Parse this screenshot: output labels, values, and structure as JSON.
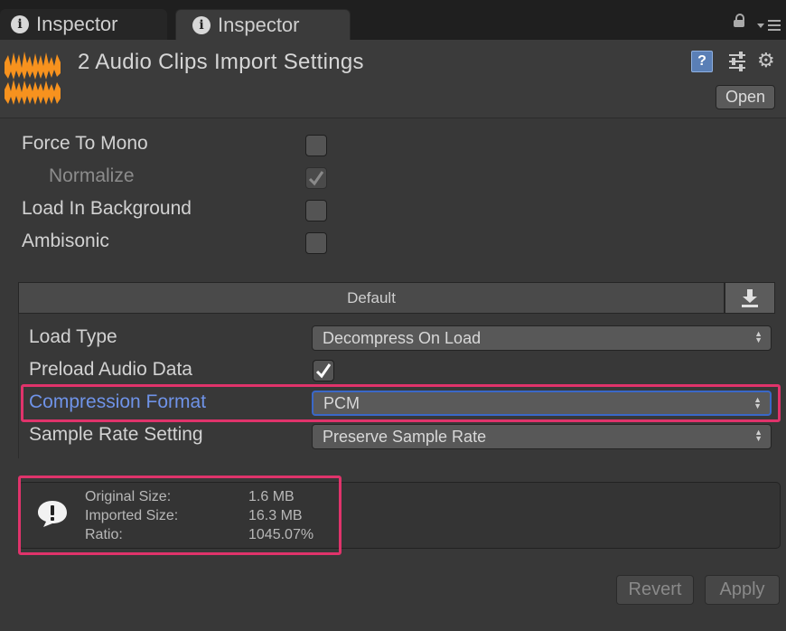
{
  "tabs": [
    {
      "label": "Inspector"
    },
    {
      "label": "Inspector"
    }
  ],
  "header": {
    "title": "2 Audio Clips Import Settings",
    "open_label": "Open"
  },
  "properties": {
    "force_to_mono": {
      "label": "Force To Mono",
      "checked": false
    },
    "normalize": {
      "label": "Normalize",
      "checked": true,
      "disabled": true
    },
    "load_in_background": {
      "label": "Load In Background",
      "checked": false
    },
    "ambisonic": {
      "label": "Ambisonic",
      "checked": false
    }
  },
  "platform": {
    "tab_label": "Default",
    "load_type": {
      "label": "Load Type",
      "value": "Decompress On Load"
    },
    "preload_audio_data": {
      "label": "Preload Audio Data",
      "checked": true
    },
    "compression_format": {
      "label": "Compression Format",
      "value": "PCM"
    },
    "sample_rate_setting": {
      "label": "Sample Rate Setting",
      "value": "Preserve Sample Rate"
    }
  },
  "info": {
    "original_size_label": "Original Size:",
    "original_size_value": "1.6 MB",
    "imported_size_label": "Imported Size:",
    "imported_size_value": "16.3 MB",
    "ratio_label": "Ratio:",
    "ratio_value": "1045.07%"
  },
  "buttons": {
    "revert": "Revert",
    "apply": "Apply"
  },
  "colors": {
    "highlight": "#e0336b",
    "audio_icon": "#f7921e",
    "focus_blue": "#6f93e8"
  },
  "icons": [
    "info-icon",
    "lock-icon",
    "menu-icon",
    "audio-clip-icon",
    "help-icon",
    "preset-icon",
    "gear-icon",
    "download-icon",
    "warning-icon"
  ]
}
